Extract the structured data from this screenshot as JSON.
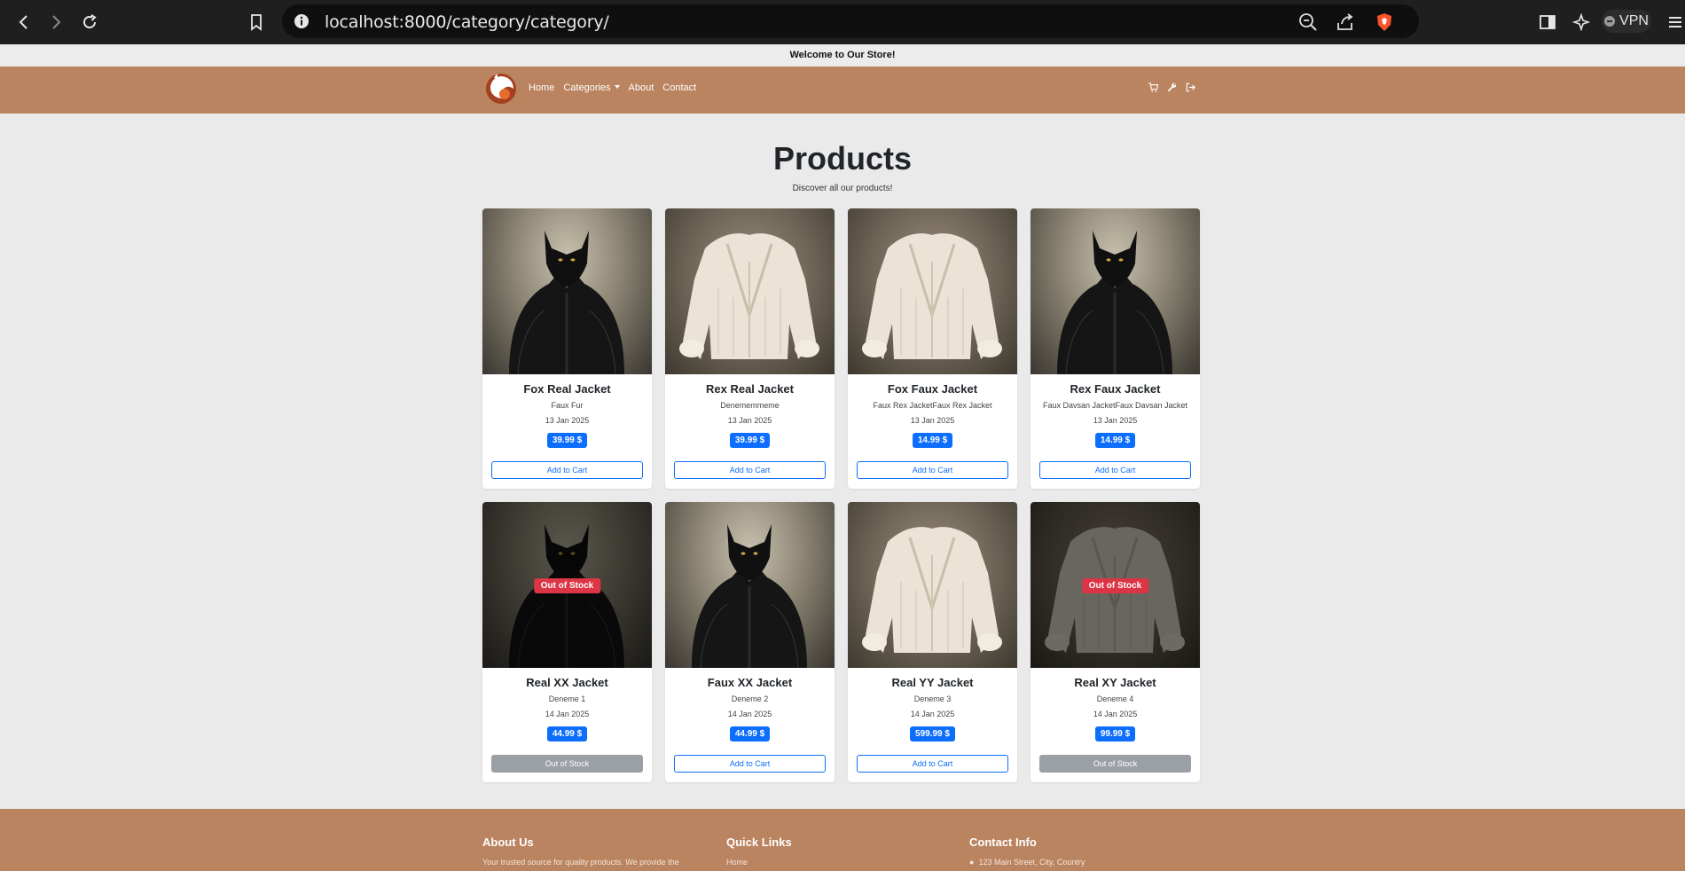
{
  "browser": {
    "url": "localhost:8000/category/category/",
    "vpn_label": "VPN"
  },
  "store": {
    "welcome": "Welcome to Our Store!",
    "nav": {
      "home": "Home",
      "categories": "Categories",
      "about": "About",
      "contact": "Contact"
    },
    "page_title": "Products",
    "page_subtitle": "Discover all our products!",
    "out_of_stock_badge": "Out of Stock"
  },
  "products": [
    {
      "name": "Fox Real Jacket",
      "desc": "Faux Fur",
      "date": "13 Jan 2025",
      "price": "39.99 $",
      "button": "Add to Cart",
      "image": "black-fur-jacket",
      "in_stock": true
    },
    {
      "name": "Rex Real Jacket",
      "desc": "Denememmeme",
      "date": "13 Jan 2025",
      "price": "39.99 $",
      "button": "Add to Cart",
      "image": "white-fur-jacket",
      "in_stock": true
    },
    {
      "name": "Fox Faux Jacket",
      "desc": "Faux Rex JacketFaux Rex Jacket",
      "date": "13 Jan 2025",
      "price": "14.99 $",
      "button": "Add to Cart",
      "image": "white-fur-jacket",
      "in_stock": true
    },
    {
      "name": "Rex Faux Jacket",
      "desc": "Faux Davsan JacketFaux Davsan Jacket",
      "date": "13 Jan 2025",
      "price": "14.99 $",
      "button": "Add to Cart",
      "image": "black-fur-jacket",
      "in_stock": true
    },
    {
      "name": "Real XX Jacket",
      "desc": "Deneme 1",
      "date": "14 Jan 2025",
      "price": "44.99 $",
      "button": "Out of Stock",
      "image": "black-fur-jacket",
      "in_stock": false
    },
    {
      "name": "Faux XX Jacket",
      "desc": "Deneme 2",
      "date": "14 Jan 2025",
      "price": "44.99 $",
      "button": "Add to Cart",
      "image": "black-fur-jacket",
      "in_stock": true
    },
    {
      "name": "Real YY Jacket",
      "desc": "Deneme 3",
      "date": "14 Jan 2025",
      "price": "599.99 $",
      "button": "Add to Cart",
      "image": "white-fur-jacket",
      "in_stock": true
    },
    {
      "name": "Real XY Jacket",
      "desc": "Deneme 4",
      "date": "14 Jan 2025",
      "price": "99.99 $",
      "button": "Out of Stock",
      "image": "white-fur-jacket",
      "in_stock": false
    }
  ],
  "footer": {
    "about_title": "About Us",
    "about_text": "Your trusted source for quality products. We provide the",
    "links_title": "Quick Links",
    "links_first": "Home",
    "contact_title": "Contact Info",
    "contact_address": "123 Main Street, City, Country"
  },
  "colors": {
    "brand": "#bb8460",
    "primary": "#0d6efd",
    "danger": "#dc3545",
    "muted": "#9aa0a6"
  }
}
